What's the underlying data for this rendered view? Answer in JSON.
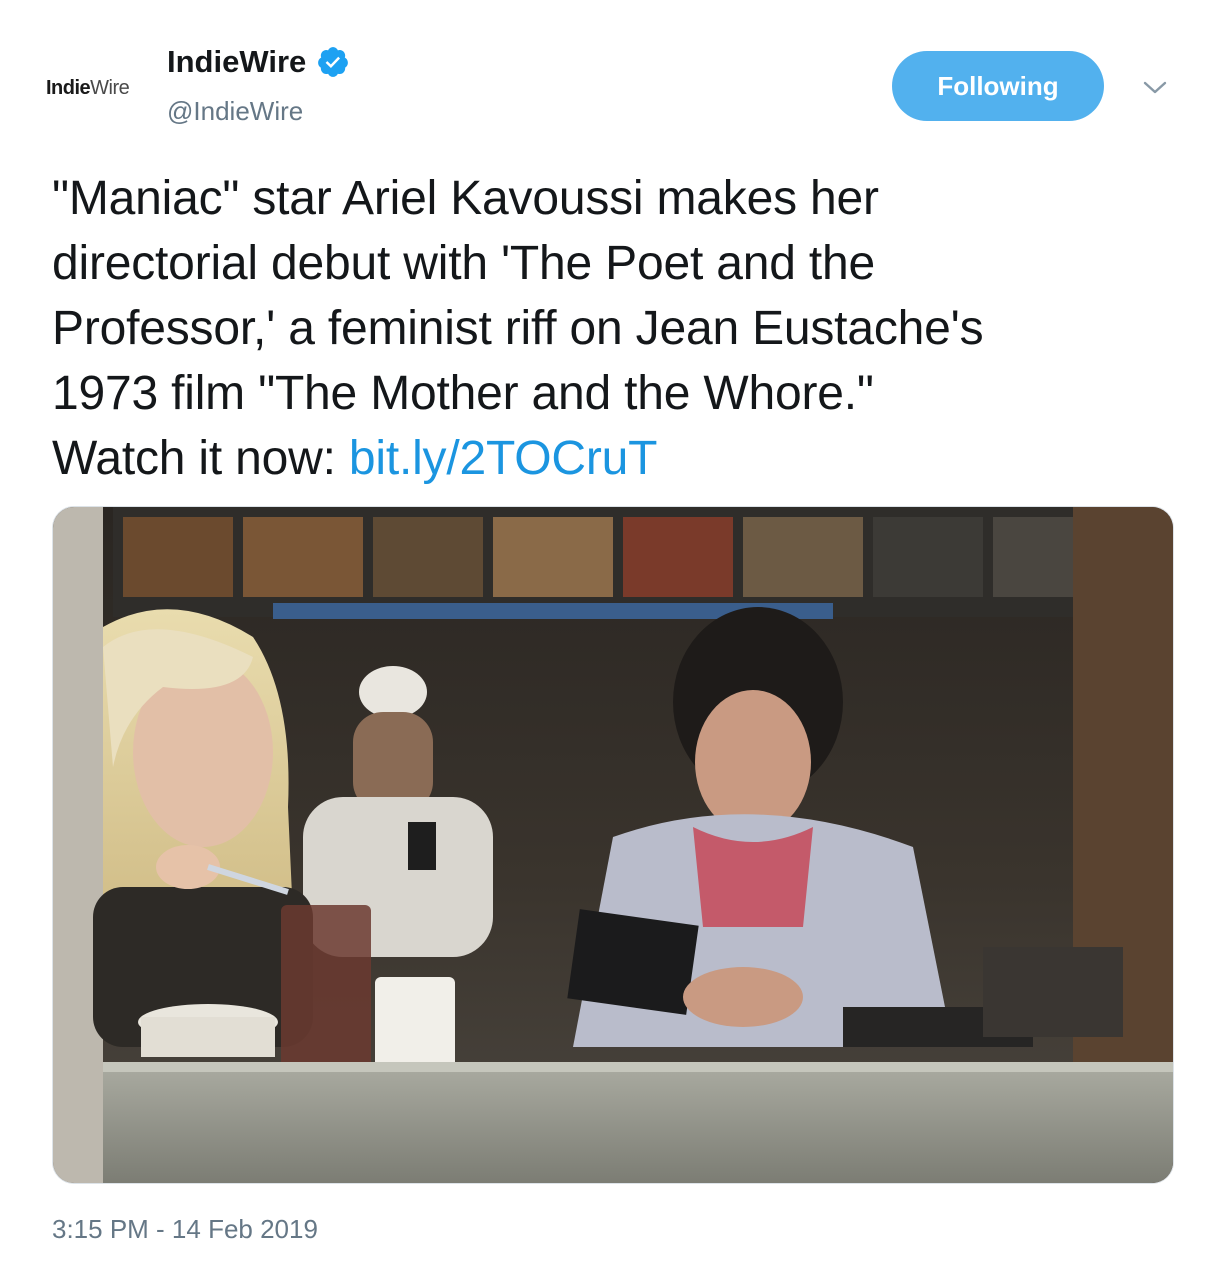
{
  "account": {
    "avatar_text_bold": "Indie",
    "avatar_text_light": "Wire",
    "display_name": "IndieWire",
    "handle": "@IndieWire",
    "verified": true
  },
  "actions": {
    "follow_label": "Following",
    "menu_icon": "chevron-down-icon"
  },
  "tweet": {
    "lines": [
      "\"Maniac\" star Ariel Kavoussi makes her",
      "directorial debut with 'The Poet and the",
      "Professor,' a feminist riff on Jean Eustache's",
      "1973 film \"The Mother and the Whore.\""
    ],
    "last_line_prefix": "Watch it now: ",
    "link_text": "bit.ly/2TOCruT",
    "timestamp": "3:15 PM - 14 Feb 2019"
  },
  "colors": {
    "accent": "#1b95e0",
    "button": "#52b1ee",
    "muted": "#657786"
  }
}
